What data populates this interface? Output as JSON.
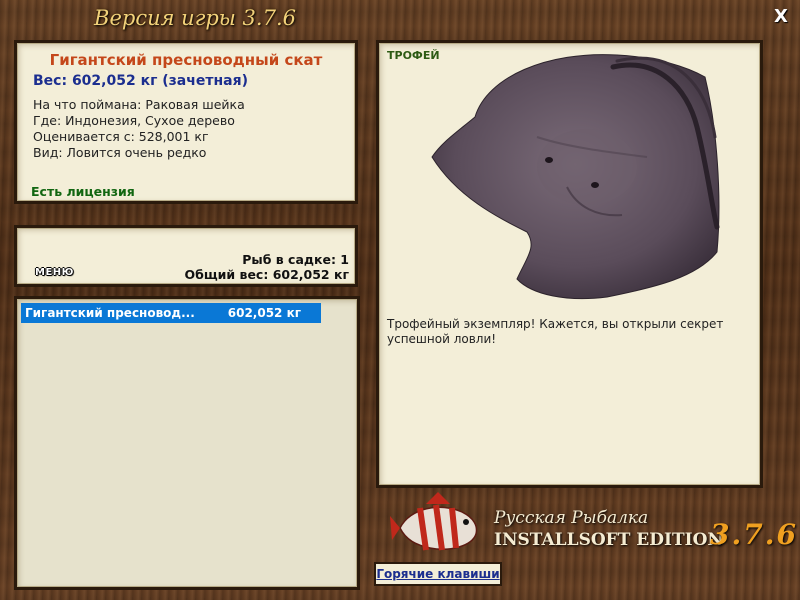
{
  "window": {
    "title": "Версия игры 3.7.6",
    "close_label": "X"
  },
  "fish_info": {
    "name": "Гигантский пресноводный скат",
    "weight": "Вес: 602,052 кг (зачетная)",
    "caught_on": "На что поймана: Раковая шейка",
    "location": "Где: Индонезия, Сухое дерево",
    "valued_from": "Оценивается с: 528,001 кг",
    "rarity": "Вид: Ловится очень редко",
    "license": "Есть лицензия"
  },
  "summary": {
    "menu_label": "МЕНЮ",
    "fish_count": "Рыб в садке: 1",
    "total_weight": "Общий вес: 602,052 кг"
  },
  "catch_list": [
    {
      "name": "Гигантский пресновод...",
      "weight": "602,052 кг",
      "selected": true
    }
  ],
  "trophy": {
    "tag": "ТРОФЕЙ",
    "description": "Трофейный экземпляр! Кажется, вы открыли секрет успешной ловли!",
    "image_icon": "stingray-icon"
  },
  "branding": {
    "line1": "Русская Рыбалка",
    "line2": "INSTALLSOFT EDITION",
    "version": "3.7.6",
    "logo_icon": "striped-fish-icon"
  },
  "footer": {
    "hotkeys_label": "Горячие клавиши"
  },
  "colors": {
    "fish_name": "#c4471a",
    "weight": "#1b2e8f",
    "license": "#116611",
    "selection": "#0a78d6",
    "version": "#f0a020"
  }
}
